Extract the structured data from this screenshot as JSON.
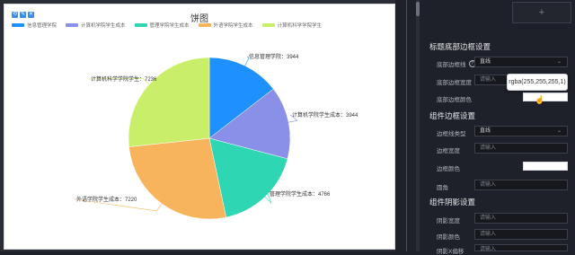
{
  "chart_card": {
    "toolbar": [
      "⟲",
      "✎",
      "✕"
    ],
    "title": "饼图",
    "legend": [
      {
        "name": "信息管理学院",
        "color": "#1e90ff"
      },
      {
        "name": "计算机学院学生成本",
        "color": "#8a8fe8"
      },
      {
        "name": "管理学院学生成本",
        "color": "#2fd6b4"
      },
      {
        "name": "外语学院学生成本",
        "color": "#f7b45c"
      },
      {
        "name": "计算机科学学院学生",
        "color": "#c9ef6a"
      }
    ],
    "slice_labels": [
      "信息管理学院：3944",
      "计算机学院学生成本：3944",
      "管理学院学生成本：4766",
      "外语学院学生成本：7220",
      "计算机科学学院学生：7236"
    ]
  },
  "chart_data": {
    "type": "pie",
    "title": "饼图",
    "categories": [
      "信息管理学院",
      "计算机学院学生成本",
      "管理学院学生成本",
      "外语学院学生成本",
      "计算机科学学院学生"
    ],
    "values": [
      3944,
      3944,
      4766,
      7220,
      7236
    ],
    "colors": [
      "#1e90ff",
      "#8a8fe8",
      "#2fd6b4",
      "#f7b45c",
      "#c9ef6a"
    ],
    "legend_position": "top-left"
  },
  "panel": {
    "upload_icon": "plus-icon",
    "sections": {
      "title_border": "标题底部边框设置",
      "component_border": "组件边框设置",
      "component_shadow": "组件阴影设置"
    },
    "title_border": {
      "line_style_label": "底部边框线",
      "line_style_value": "直线",
      "width_label": "底部边框宽度",
      "width_placeholder": "请输入",
      "color_label": "底部边框颜色",
      "color_value": "#ffffff"
    },
    "component_border": {
      "type_label": "边框线类型",
      "type_value": "直线",
      "width_label": "边框宽度",
      "width_placeholder": "请输入",
      "color_label": "边框颜色",
      "color_value": "#ffffff",
      "radius_label": "圆角",
      "radius_placeholder": "请输入"
    },
    "component_shadow": {
      "width_label": "阴影宽度",
      "width_placeholder": "请输入",
      "color_label": "阴影颜色",
      "color_placeholder": "请输入",
      "offset_label": "阴影X偏移",
      "offset_placeholder": "请输入"
    },
    "tooltip": "rgba(255,255,255,1)"
  }
}
